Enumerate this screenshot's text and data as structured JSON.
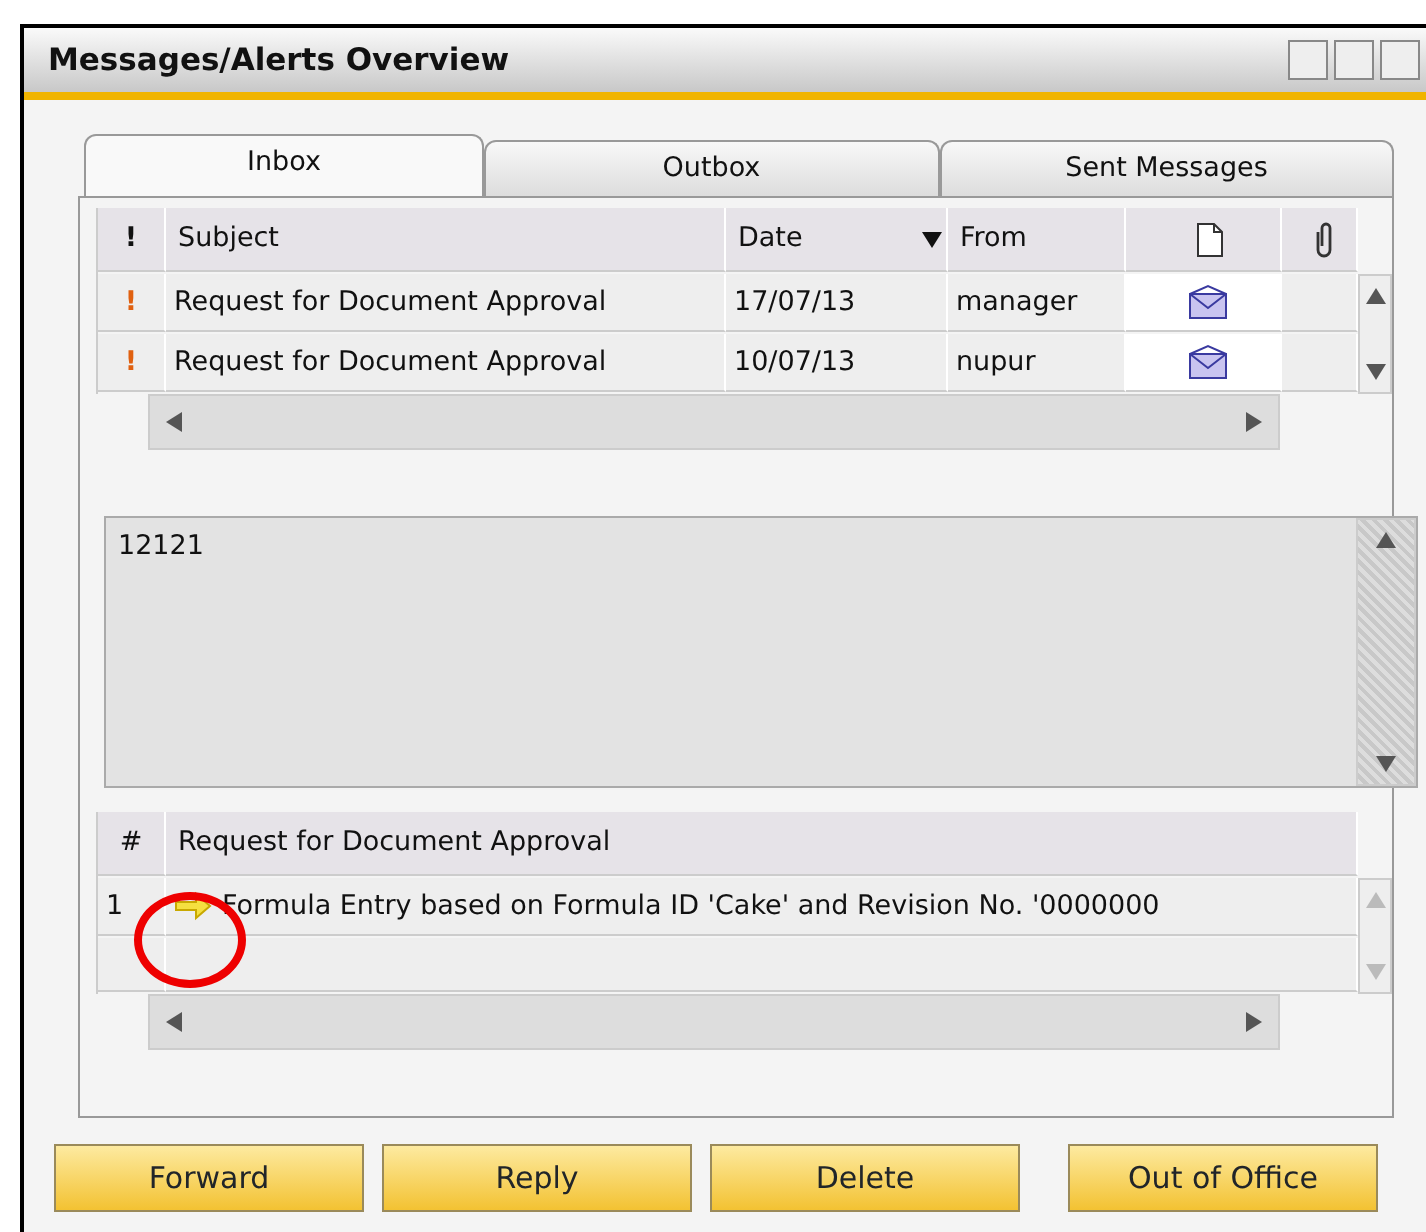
{
  "window": {
    "title": "Messages/Alerts Overview"
  },
  "tabs": [
    {
      "label": "Inbox",
      "selected": true
    },
    {
      "label": "Outbox",
      "selected": false
    },
    {
      "label": "Sent Messages",
      "selected": false
    }
  ],
  "messages": {
    "columns": [
      {
        "label": "!",
        "sorted": false
      },
      {
        "label": "Subject",
        "sorted": false
      },
      {
        "label": "Date",
        "sorted": true
      },
      {
        "label": "From",
        "sorted": false
      }
    ],
    "rows": [
      {
        "priority": "!",
        "subject": "Request for Document Approval",
        "date": "17/07/13",
        "from": "manager"
      },
      {
        "priority": "!",
        "subject": "Request for Document Approval",
        "date": "10/07/13",
        "from": "nupur"
      }
    ]
  },
  "body": {
    "text": "12121"
  },
  "activities": {
    "columns": [
      "#",
      "Request for Document Approval"
    ],
    "rows": [
      {
        "number": "1",
        "text": "Formula Entry based on Formula ID 'Cake' and Revision No. '0000000"
      }
    ]
  },
  "buttons": [
    "Forward",
    "Reply",
    "Delete",
    "Out of Office"
  ]
}
